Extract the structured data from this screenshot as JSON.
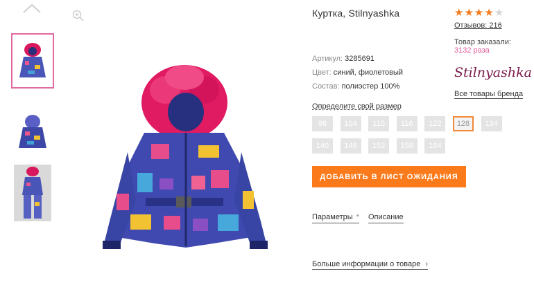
{
  "product": {
    "title": "Куртка, Stilnyashka",
    "article_label": "Артикул:",
    "article_value": "3285691",
    "color_label": "Цвет:",
    "color_value": "синий, фиолетовый",
    "material_label": "Состав:",
    "material_value": "полиэстер 100%"
  },
  "size_guide_link": "Определите свой размер",
  "sizes": [
    {
      "label": "98",
      "selected": false
    },
    {
      "label": "104",
      "selected": false
    },
    {
      "label": "110",
      "selected": false
    },
    {
      "label": "116",
      "selected": false
    },
    {
      "label": "122",
      "selected": false
    },
    {
      "label": "128",
      "selected": true
    },
    {
      "label": "134",
      "selected": false
    },
    {
      "label": "140",
      "selected": false
    },
    {
      "label": "146",
      "selected": false
    },
    {
      "label": "152",
      "selected": false
    },
    {
      "label": "158",
      "selected": false
    },
    {
      "label": "164",
      "selected": false
    }
  ],
  "wait_button": "ДОБАВИТЬ В ЛИСТ ОЖИДАНИЯ",
  "tabs": {
    "params": "Параметры",
    "params_marker": "*",
    "description": "Описание"
  },
  "more_info": "Больше информации о товаре",
  "rating": {
    "value": 4,
    "max": 5,
    "filled_color": "#f57c1f",
    "empty_color": "#d5d5d5"
  },
  "reviews_link": "Отзывов: 216",
  "ordered_label": "Товар заказали:",
  "ordered_count": "3132 раза",
  "brand_logo": "Stilnyashka",
  "brand_link": "Все товары бренда",
  "icons": {
    "up": "chevron-up-icon",
    "zoom": "zoom-in-icon",
    "more": "chevron-right-icon"
  },
  "colors": {
    "accent": "#fb7a1b",
    "selected_border": "#f28a3a",
    "active_thumb": "#e06aa0",
    "pink_text": "#e0589c"
  }
}
